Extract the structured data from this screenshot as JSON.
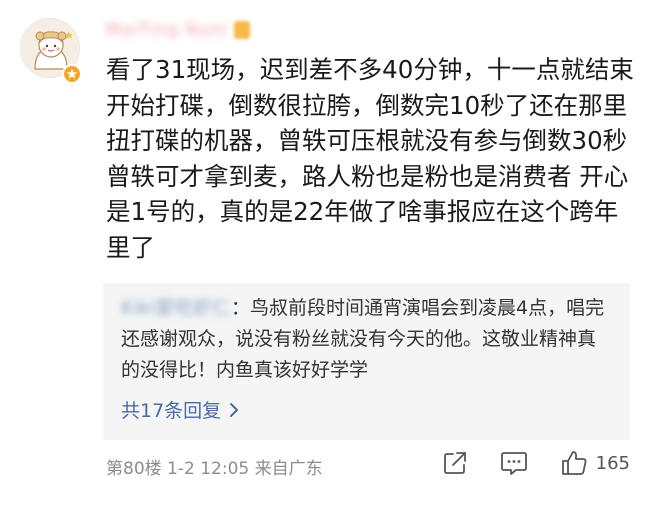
{
  "user": {
    "name": "MaiTing Nuni"
  },
  "comment": {
    "text": "看了31现场，迟到差不多40分钟，十一点就结束开始打碟，倒数很拉胯，倒数完10秒了还在那里扭打碟的机器，曾轶可压根就没有参与倒数30秒曾轶可才拿到麦，路人粉也是粉也是消费者 开心是1号的，真的是22年做了啥事报应在这个跨年里了"
  },
  "reply": {
    "author": "Kiki爱吃虾仁",
    "separator": "：",
    "text": "鸟叔前段时间通宵演唱会到凌晨4点，唱完还感谢观众，说没有粉丝就没有今天的他。这敬业精神真的没得比！内鱼真该好好学学",
    "more_label": "共17条回复"
  },
  "meta": {
    "text": "第80楼  1-2 12:05  来自广东"
  },
  "actions": {
    "like_count": "165"
  },
  "colors": {
    "accent_blue": "#4a6aa5",
    "badge_gold": "#f5a623",
    "username_pink": "#f0a0a6"
  },
  "icons": [
    "avatar-illustration",
    "verified-badge-icon",
    "share-icon",
    "comment-icon",
    "like-icon",
    "chevron-right-icon"
  ]
}
